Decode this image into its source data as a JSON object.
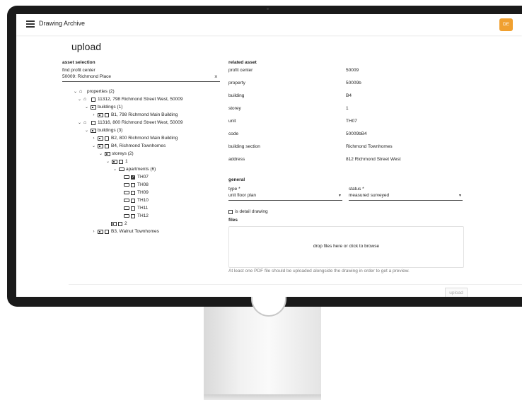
{
  "app": {
    "title": "Drawing Archive",
    "user_initials": "DE"
  },
  "page": {
    "title": "upload"
  },
  "asset_selection": {
    "label": "asset selection",
    "field_label": "find profit center",
    "field_value": "50009: Richmond Place",
    "clear_icon": "×"
  },
  "tree": [
    {
      "label": "properties (2)"
    },
    {
      "label": "11312, 798 Richmond Street West, 50009"
    },
    {
      "label": "buildings (1)"
    },
    {
      "label": "B1, 798 Richmond Main Building"
    },
    {
      "label": "11316, 800 Richmond Street West, 50009"
    },
    {
      "label": "buildings (3)"
    },
    {
      "label": "B2, 800 Richmond Main Building"
    },
    {
      "label": "B4, Richmond Townhomes"
    },
    {
      "label": "storeys (2)"
    },
    {
      "label": "1"
    },
    {
      "label": "apartments (6)"
    },
    {
      "label": "TH07"
    },
    {
      "label": "TH08"
    },
    {
      "label": "TH09"
    },
    {
      "label": "TH10"
    },
    {
      "label": "TH11"
    },
    {
      "label": "TH12"
    },
    {
      "label": "2"
    },
    {
      "label": "B3, Walnut Townhomes"
    }
  ],
  "related_asset": {
    "label": "related asset",
    "rows": [
      {
        "key": "profit center",
        "value": "50009"
      },
      {
        "key": "property",
        "value": "50009b"
      },
      {
        "key": "building",
        "value": "B4"
      },
      {
        "key": "storey",
        "value": "1"
      },
      {
        "key": "unit",
        "value": "TH07"
      },
      {
        "key": "code",
        "value": "50009bB4"
      },
      {
        "key": "building section",
        "value": "Richmond Townhomes"
      },
      {
        "key": "address",
        "value": "812 Richmond Street West"
      }
    ]
  },
  "general": {
    "label": "general",
    "type_label": "type *",
    "type_value": "unit floor plan",
    "status_label": "status *",
    "status_value": "measured surveyed",
    "detail_label": "is detail drawing",
    "files_label": "files",
    "dropzone_text": "drop files here or click to browse",
    "footnote": "At least one PDF file should be uploaded alongside the drawing in order to get a preview.",
    "upload_label": "upload"
  },
  "colors": {
    "avatar": "#f0a030",
    "bezel": "#1a1a1a"
  }
}
